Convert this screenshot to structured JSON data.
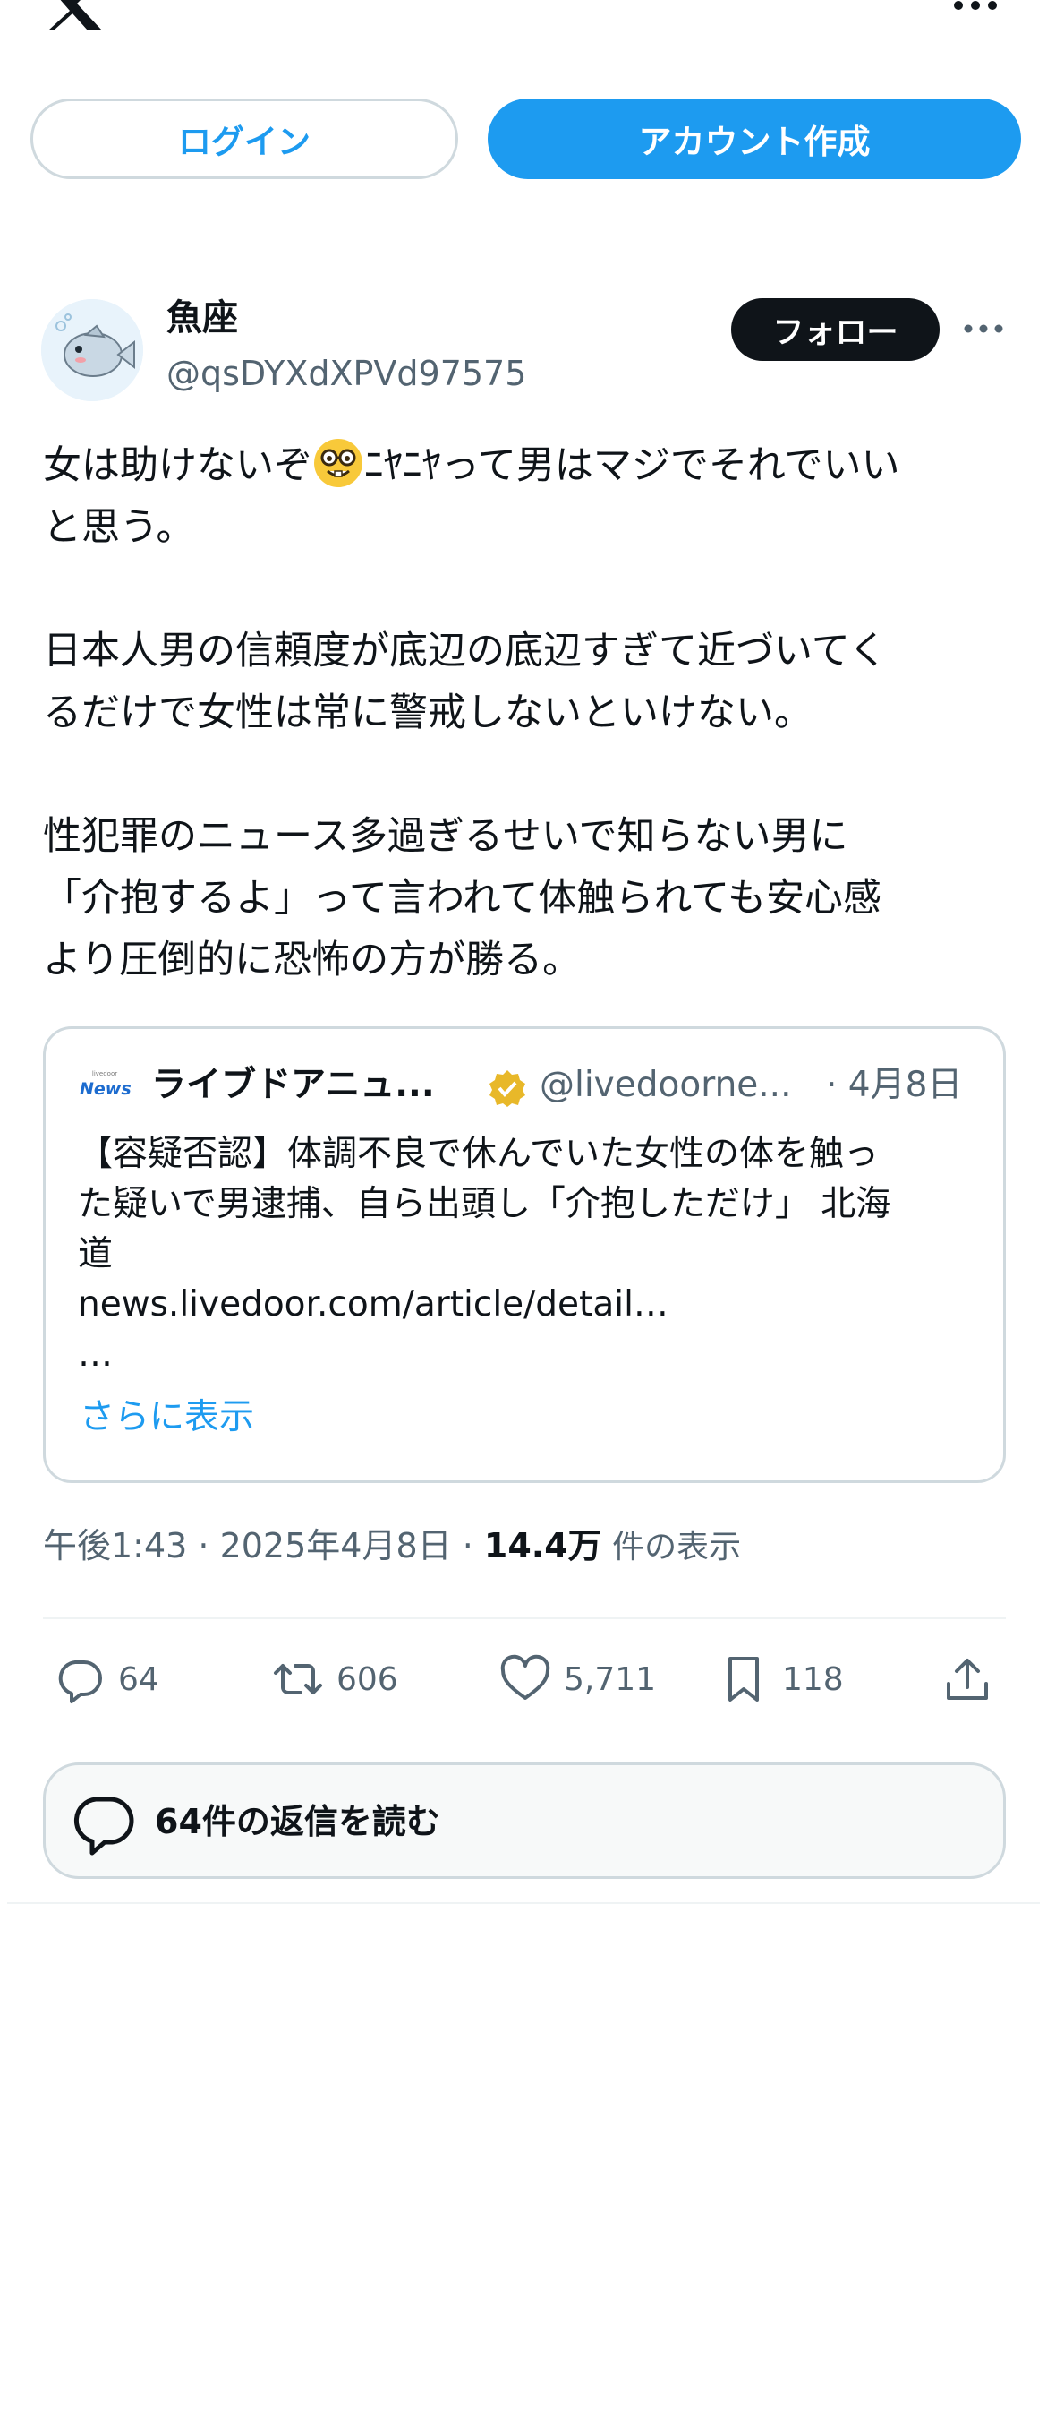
{
  "header": {
    "logo_icon": "x-logo-icon",
    "more_icon": "more-horizontal-icon"
  },
  "auth": {
    "login_label": "ログイン",
    "signup_label": "アカウント作成"
  },
  "tweet": {
    "author_name": "魚座",
    "author_handle": "@qsDYXdXPVd97575",
    "follow_label": "フォロー",
    "text_part1": "女は助けないぞ",
    "emoji": "nerd-face-emoji",
    "text_part2": "ﾆﾔﾆﾔって男はマジでそれでいい\nと思う。\n\n日本人男の信頼度が底辺の底辺すぎて近づいてく\nるだけで女性は常に警戒しないといけない。\n\n性犯罪のニュース多過ぎるせいで知らない男に\n「介抱するよ」って言われて体触られても安心感\nより圧倒的に恐怖の方が勝る。",
    "quote": {
      "source_logo_small": "livedoor",
      "source_logo": "News",
      "name": "ライブドアニュ...",
      "handle": "@livedoorne...",
      "date": "· 4月8日",
      "body": "【容疑否認】体調不良で休んでいた女性の体を触っ\nた疑いで男逮捕、自ら出頭し「介抱しただけ」 北海\n道\nnews.livedoor.com/article/detail…\n…",
      "show_more": "さらに表示"
    },
    "timestamp": "午後1:43 · 2025年4月8日 · ",
    "views_count": "14.4万",
    "views_label": " 件の表示",
    "stats": {
      "replies": "64",
      "retweets": "606",
      "likes": "5,711",
      "bookmarks": "118"
    },
    "read_replies_label": "64件の返信を読む"
  },
  "colors": {
    "accent": "#1d9bf0",
    "text": "#0f1419",
    "secondary": "#536471",
    "border": "#cfd9de",
    "verified_gold": "#e8b829"
  }
}
